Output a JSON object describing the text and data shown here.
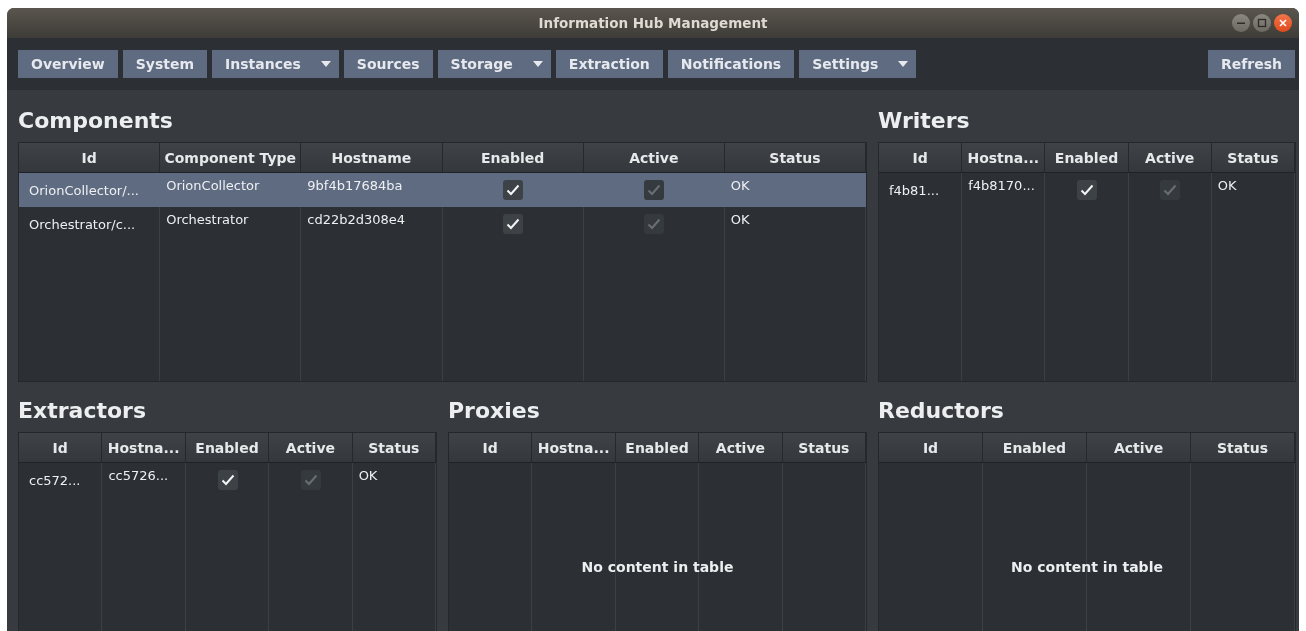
{
  "window": {
    "title": "Information Hub Management"
  },
  "toolbar": [
    {
      "label": "Overview",
      "dropdown": false
    },
    {
      "label": "System",
      "dropdown": false
    },
    {
      "label": "Instances",
      "dropdown": true
    },
    {
      "label": "Sources",
      "dropdown": false
    },
    {
      "label": "Storage",
      "dropdown": true
    },
    {
      "label": "Extraction",
      "dropdown": false
    },
    {
      "label": "Notifications",
      "dropdown": false
    },
    {
      "label": "Settings",
      "dropdown": true
    }
  ],
  "refresh_button": "Refresh",
  "panel_rows": [
    [
      {
        "title": "Components",
        "columns": [
          "Id",
          "Component Type",
          "Hostname",
          "Enabled",
          "Active",
          "Status"
        ],
        "rows": [
          {
            "selected": true,
            "cells": [
              {
                "kind": "text",
                "text": "OrionCollector/..."
              },
              {
                "kind": "text",
                "text": "OrionCollector"
              },
              {
                "kind": "text",
                "text": "9bf4b17684ba"
              },
              {
                "kind": "check",
                "checked": true,
                "disabled": false
              },
              {
                "kind": "check",
                "checked": true,
                "disabled": true
              },
              {
                "kind": "text",
                "text": "OK"
              }
            ]
          },
          {
            "selected": false,
            "cells": [
              {
                "kind": "text",
                "text": "Orchestrator/c..."
              },
              {
                "kind": "text",
                "text": "Orchestrator"
              },
              {
                "kind": "text",
                "text": "cd22b2d308e4"
              },
              {
                "kind": "check",
                "checked": true,
                "disabled": false
              },
              {
                "kind": "check",
                "checked": true,
                "disabled": true
              },
              {
                "kind": "text",
                "text": "OK"
              }
            ]
          }
        ]
      },
      {
        "title": "Writers",
        "columns": [
          "Id",
          "Hostna...",
          "Enabled",
          "Active",
          "Status"
        ],
        "rows": [
          {
            "selected": false,
            "cells": [
              {
                "kind": "text",
                "text": "f4b81..."
              },
              {
                "kind": "text",
                "text": "f4b8170..."
              },
              {
                "kind": "check",
                "checked": true,
                "disabled": false
              },
              {
                "kind": "check",
                "checked": true,
                "disabled": true
              },
              {
                "kind": "text",
                "text": "OK"
              }
            ]
          }
        ]
      }
    ],
    [
      {
        "title": "Extractors",
        "columns": [
          "Id",
          "Hostna...",
          "Enabled",
          "Active",
          "Status"
        ],
        "rows": [
          {
            "selected": false,
            "cells": [
              {
                "kind": "text",
                "text": "cc572..."
              },
              {
                "kind": "text",
                "text": "cc5726..."
              },
              {
                "kind": "check",
                "checked": true,
                "disabled": false
              },
              {
                "kind": "check",
                "checked": true,
                "disabled": true
              },
              {
                "kind": "text",
                "text": "OK"
              }
            ]
          }
        ]
      },
      {
        "title": "Proxies",
        "columns": [
          "Id",
          "Hostna...",
          "Enabled",
          "Active",
          "Status"
        ],
        "empty_text": "No content in table"
      },
      {
        "title": "Reductors",
        "columns": [
          "Id",
          "Enabled",
          "Active",
          "Status"
        ],
        "empty_text": "No content in table"
      }
    ]
  ]
}
